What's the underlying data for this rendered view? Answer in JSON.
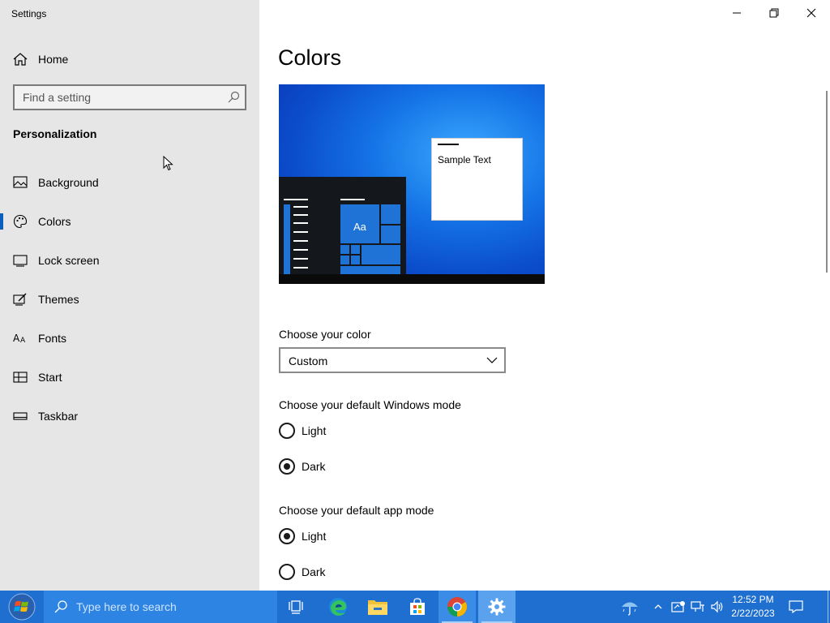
{
  "window": {
    "title": "Settings"
  },
  "sidebar": {
    "home_label": "Home",
    "search_placeholder": "Find a setting",
    "section_title": "Personalization",
    "items": [
      {
        "label": "Background",
        "icon": "image-icon"
      },
      {
        "label": "Colors",
        "icon": "palette-icon",
        "active": true
      },
      {
        "label": "Lock screen",
        "icon": "lock-screen-icon"
      },
      {
        "label": "Themes",
        "icon": "themes-icon"
      },
      {
        "label": "Fonts",
        "icon": "fonts-icon"
      },
      {
        "label": "Start",
        "icon": "start-icon"
      },
      {
        "label": "Taskbar",
        "icon": "taskbar-icon"
      }
    ]
  },
  "main": {
    "title": "Colors",
    "preview": {
      "sample_text": "Sample Text",
      "tile_text": "Aa"
    },
    "choose_color": {
      "label": "Choose your color",
      "value": "Custom"
    },
    "windows_mode": {
      "label": "Choose your default Windows mode",
      "options": [
        "Light",
        "Dark"
      ],
      "selected": "Dark"
    },
    "app_mode": {
      "label": "Choose your default app mode",
      "options": [
        "Light",
        "Dark"
      ],
      "selected": "Light"
    }
  },
  "taskbar": {
    "search_placeholder": "Type here to search",
    "time": "12:52 PM",
    "date": "2/22/2023"
  },
  "colors": {
    "accent": "#0a5fbe",
    "sidebar_bg": "#e6e6e6",
    "taskbar_bg": "#1f6fd1"
  }
}
